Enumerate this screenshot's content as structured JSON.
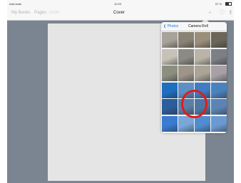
{
  "status": {
    "carrier": "Add-tank",
    "wifi": "≈",
    "time": "10:29",
    "battery": "57 %"
  },
  "navbar": {
    "left_items": [
      "My Books",
      "Pages",
      "Undo"
    ],
    "title": "Cover",
    "icons": [
      "add-icon",
      "info-icon",
      "share-icon"
    ]
  },
  "picker": {
    "back_label": "Photos",
    "title": "Camera Roll",
    "rows": [
      [
        "#a7a39a",
        "#8a8375",
        "#9a8f7a",
        "#6b6658"
      ],
      [
        "#c7c2b8",
        "#8c8a85",
        "#b9b4a6",
        "#7b7f86"
      ],
      [
        "#8c8f80",
        "#9e958a",
        "#aaa396",
        "#a7a0a5"
      ],
      [
        "#1f6fc0",
        "#5d8fc4",
        "#3f7dc2",
        "#4a82c0"
      ],
      [
        "#2d5d9b",
        "#5a7ea6",
        "#4d77a3",
        "#5b84b4"
      ],
      [
        "#3a7bd0",
        "#7aa6d8",
        "#4f8dd0",
        "#6a9ad1"
      ]
    ]
  },
  "highlight": {
    "color": "#e31b1b"
  }
}
